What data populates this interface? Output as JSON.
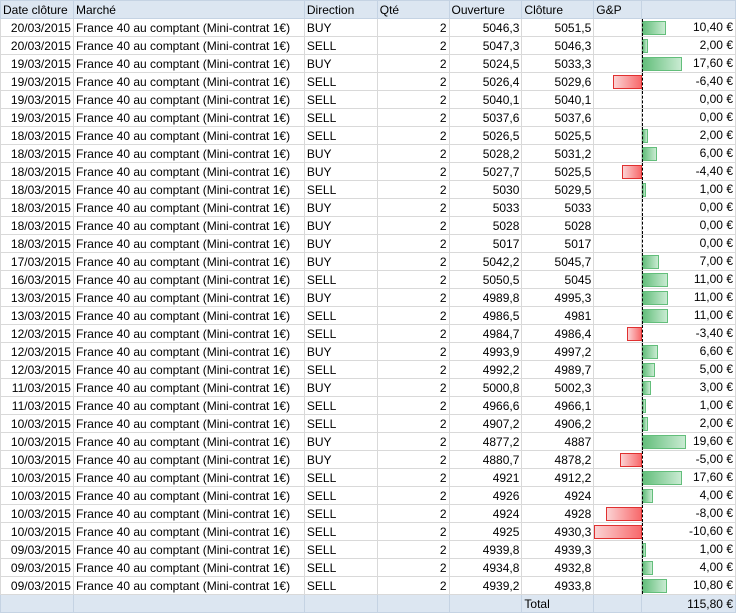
{
  "headers": {
    "date": "Date clôture",
    "market": "Marché",
    "direction": "Direction",
    "qty": "Qté",
    "open": "Ouverture",
    "close": "Clôture",
    "gp": "G&P"
  },
  "rows": [
    {
      "date": "20/03/2015",
      "market": "France 40 au comptant (Mini-contrat 1€)",
      "direction": "BUY",
      "qty": "2",
      "open": "5046,3",
      "close": "5051,5",
      "gp": "10,40 €",
      "gp_value": 10.4
    },
    {
      "date": "20/03/2015",
      "market": "France 40 au comptant (Mini-contrat 1€)",
      "direction": "SELL",
      "qty": "2",
      "open": "5047,3",
      "close": "5046,3",
      "gp": "2,00 €",
      "gp_value": 2.0
    },
    {
      "date": "19/03/2015",
      "market": "France 40 au comptant (Mini-contrat 1€)",
      "direction": "BUY",
      "qty": "2",
      "open": "5024,5",
      "close": "5033,3",
      "gp": "17,60 €",
      "gp_value": 17.6
    },
    {
      "date": "19/03/2015",
      "market": "France 40 au comptant (Mini-contrat 1€)",
      "direction": "SELL",
      "qty": "2",
      "open": "5026,4",
      "close": "5029,6",
      "gp": "-6,40 €",
      "gp_value": -6.4
    },
    {
      "date": "19/03/2015",
      "market": "France 40 au comptant (Mini-contrat 1€)",
      "direction": "SELL",
      "qty": "2",
      "open": "5040,1",
      "close": "5040,1",
      "gp": "0,00 €",
      "gp_value": 0
    },
    {
      "date": "19/03/2015",
      "market": "France 40 au comptant (Mini-contrat 1€)",
      "direction": "SELL",
      "qty": "2",
      "open": "5037,6",
      "close": "5037,6",
      "gp": "0,00 €",
      "gp_value": 0
    },
    {
      "date": "18/03/2015",
      "market": "France 40 au comptant (Mini-contrat 1€)",
      "direction": "SELL",
      "qty": "2",
      "open": "5026,5",
      "close": "5025,5",
      "gp": "2,00 €",
      "gp_value": 2.0
    },
    {
      "date": "18/03/2015",
      "market": "France 40 au comptant (Mini-contrat 1€)",
      "direction": "BUY",
      "qty": "2",
      "open": "5028,2",
      "close": "5031,2",
      "gp": "6,00 €",
      "gp_value": 6.0
    },
    {
      "date": "18/03/2015",
      "market": "France 40 au comptant (Mini-contrat 1€)",
      "direction": "BUY",
      "qty": "2",
      "open": "5027,7",
      "close": "5025,5",
      "gp": "-4,40 €",
      "gp_value": -4.4
    },
    {
      "date": "18/03/2015",
      "market": "France 40 au comptant (Mini-contrat 1€)",
      "direction": "SELL",
      "qty": "2",
      "open": "5030",
      "close": "5029,5",
      "gp": "1,00 €",
      "gp_value": 1.0
    },
    {
      "date": "18/03/2015",
      "market": "France 40 au comptant (Mini-contrat 1€)",
      "direction": "BUY",
      "qty": "2",
      "open": "5033",
      "close": "5033",
      "gp": "0,00 €",
      "gp_value": 0
    },
    {
      "date": "18/03/2015",
      "market": "France 40 au comptant (Mini-contrat 1€)",
      "direction": "BUY",
      "qty": "2",
      "open": "5028",
      "close": "5028",
      "gp": "0,00 €",
      "gp_value": 0
    },
    {
      "date": "18/03/2015",
      "market": "France 40 au comptant (Mini-contrat 1€)",
      "direction": "BUY",
      "qty": "2",
      "open": "5017",
      "close": "5017",
      "gp": "0,00 €",
      "gp_value": 0
    },
    {
      "date": "17/03/2015",
      "market": "France 40 au comptant (Mini-contrat 1€)",
      "direction": "BUY",
      "qty": "2",
      "open": "5042,2",
      "close": "5045,7",
      "gp": "7,00 €",
      "gp_value": 7.0
    },
    {
      "date": "16/03/2015",
      "market": "France 40 au comptant (Mini-contrat 1€)",
      "direction": "SELL",
      "qty": "2",
      "open": "5050,5",
      "close": "5045",
      "gp": "11,00 €",
      "gp_value": 11.0
    },
    {
      "date": "13/03/2015",
      "market": "France 40 au comptant (Mini-contrat 1€)",
      "direction": "BUY",
      "qty": "2",
      "open": "4989,8",
      "close": "4995,3",
      "gp": "11,00 €",
      "gp_value": 11.0
    },
    {
      "date": "13/03/2015",
      "market": "France 40 au comptant (Mini-contrat 1€)",
      "direction": "SELL",
      "qty": "2",
      "open": "4986,5",
      "close": "4981",
      "gp": "11,00 €",
      "gp_value": 11.0
    },
    {
      "date": "12/03/2015",
      "market": "France 40 au comptant (Mini-contrat 1€)",
      "direction": "SELL",
      "qty": "2",
      "open": "4984,7",
      "close": "4986,4",
      "gp": "-3,40 €",
      "gp_value": -3.4
    },
    {
      "date": "12/03/2015",
      "market": "France 40 au comptant (Mini-contrat 1€)",
      "direction": "BUY",
      "qty": "2",
      "open": "4993,9",
      "close": "4997,2",
      "gp": "6,60 €",
      "gp_value": 6.6
    },
    {
      "date": "12/03/2015",
      "market": "France 40 au comptant (Mini-contrat 1€)",
      "direction": "SELL",
      "qty": "2",
      "open": "4992,2",
      "close": "4989,7",
      "gp": "5,00 €",
      "gp_value": 5.0
    },
    {
      "date": "11/03/2015",
      "market": "France 40 au comptant (Mini-contrat 1€)",
      "direction": "BUY",
      "qty": "2",
      "open": "5000,8",
      "close": "5002,3",
      "gp": "3,00 €",
      "gp_value": 3.0
    },
    {
      "date": "11/03/2015",
      "market": "France 40 au comptant (Mini-contrat 1€)",
      "direction": "SELL",
      "qty": "2",
      "open": "4966,6",
      "close": "4966,1",
      "gp": "1,00 €",
      "gp_value": 1.0
    },
    {
      "date": "10/03/2015",
      "market": "France 40 au comptant (Mini-contrat 1€)",
      "direction": "SELL",
      "qty": "2",
      "open": "4907,2",
      "close": "4906,2",
      "gp": "2,00 €",
      "gp_value": 2.0
    },
    {
      "date": "10/03/2015",
      "market": "France 40 au comptant (Mini-contrat 1€)",
      "direction": "BUY",
      "qty": "2",
      "open": "4877,2",
      "close": "4887",
      "gp": "19,60 €",
      "gp_value": 19.6
    },
    {
      "date": "10/03/2015",
      "market": "France 40 au comptant (Mini-contrat 1€)",
      "direction": "BUY",
      "qty": "2",
      "open": "4880,7",
      "close": "4878,2",
      "gp": "-5,00 €",
      "gp_value": -5.0
    },
    {
      "date": "10/03/2015",
      "market": "France 40 au comptant (Mini-contrat 1€)",
      "direction": "SELL",
      "qty": "2",
      "open": "4921",
      "close": "4912,2",
      "gp": "17,60 €",
      "gp_value": 17.6
    },
    {
      "date": "10/03/2015",
      "market": "France 40 au comptant (Mini-contrat 1€)",
      "direction": "SELL",
      "qty": "2",
      "open": "4926",
      "close": "4924",
      "gp": "4,00 €",
      "gp_value": 4.0
    },
    {
      "date": "10/03/2015",
      "market": "France 40 au comptant (Mini-contrat 1€)",
      "direction": "SELL",
      "qty": "2",
      "open": "4924",
      "close": "4928",
      "gp": "-8,00 €",
      "gp_value": -8.0
    },
    {
      "date": "10/03/2015",
      "market": "France 40 au comptant (Mini-contrat 1€)",
      "direction": "SELL",
      "qty": "2",
      "open": "4925",
      "close": "4930,3",
      "gp": "-10,60 €",
      "gp_value": -10.6
    },
    {
      "date": "09/03/2015",
      "market": "France 40 au comptant (Mini-contrat 1€)",
      "direction": "SELL",
      "qty": "2",
      "open": "4939,8",
      "close": "4939,3",
      "gp": "1,00 €",
      "gp_value": 1.0
    },
    {
      "date": "09/03/2015",
      "market": "France 40 au comptant (Mini-contrat 1€)",
      "direction": "SELL",
      "qty": "2",
      "open": "4934,8",
      "close": "4932,8",
      "gp": "4,00 €",
      "gp_value": 4.0
    },
    {
      "date": "09/03/2015",
      "market": "France 40 au comptant (Mini-contrat 1€)",
      "direction": "SELL",
      "qty": "2",
      "open": "4939,2",
      "close": "4933,8",
      "gp": "10,80 €",
      "gp_value": 10.8
    }
  ],
  "footer": {
    "label": "Total",
    "value": "115,80 €"
  },
  "colors": {
    "positive_bar": "#63be7b",
    "negative_bar": "#f8696b",
    "header_bg": "#dce6f1"
  },
  "databar_scale": {
    "min": -10.6,
    "max": 19.6
  }
}
